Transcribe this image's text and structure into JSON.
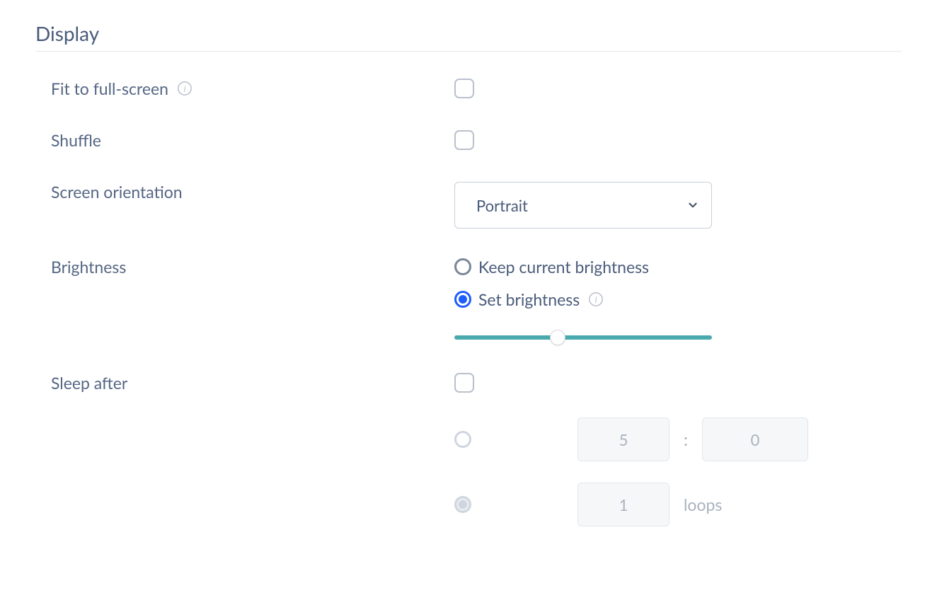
{
  "section": {
    "title": "Display"
  },
  "fit": {
    "label": "Fit to full-screen",
    "checked": false
  },
  "shuffle": {
    "label": "Shuffle",
    "checked": false
  },
  "orientation": {
    "label": "Screen orientation",
    "value": "Portrait"
  },
  "brightness": {
    "label": "Brightness",
    "keep_label": "Keep current brightness",
    "set_label": "Set brightness",
    "selected": "set",
    "slider_percent": 40
  },
  "sleep": {
    "label": "Sleep after",
    "enabled": false,
    "time_minutes": "5",
    "time_seconds": "0",
    "loops": "1",
    "loops_label": "loops"
  }
}
